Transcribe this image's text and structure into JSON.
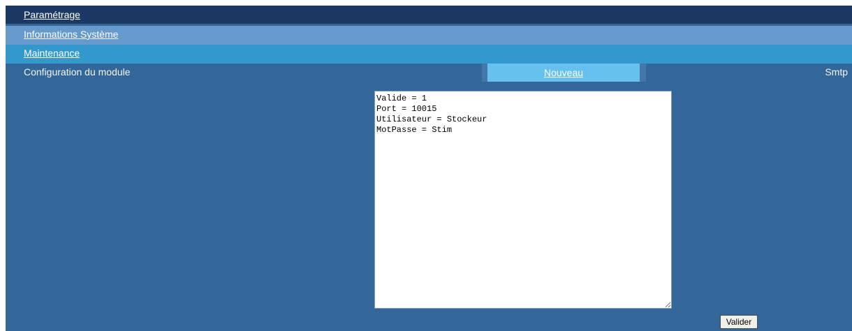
{
  "menu": {
    "parametrage": "Paramétrage",
    "informations_systeme": "Informations Système",
    "maintenance": "Maintenance"
  },
  "config": {
    "label": "Configuration du module",
    "tab_nouveau": "Nouveau",
    "module_name": "Smtp"
  },
  "editor": {
    "content": "Valide = 1\nPort = 10015\nUtilisateur = Stockeur\nMotPasse = Stim"
  },
  "actions": {
    "valider": "Valider"
  },
  "colors": {
    "page_background": "#336699",
    "menu_parametrage": "#1c3963",
    "menu_infos": "#6699cc",
    "menu_maintenance": "#3399cc",
    "tab_highlight": "#66c1ee"
  }
}
